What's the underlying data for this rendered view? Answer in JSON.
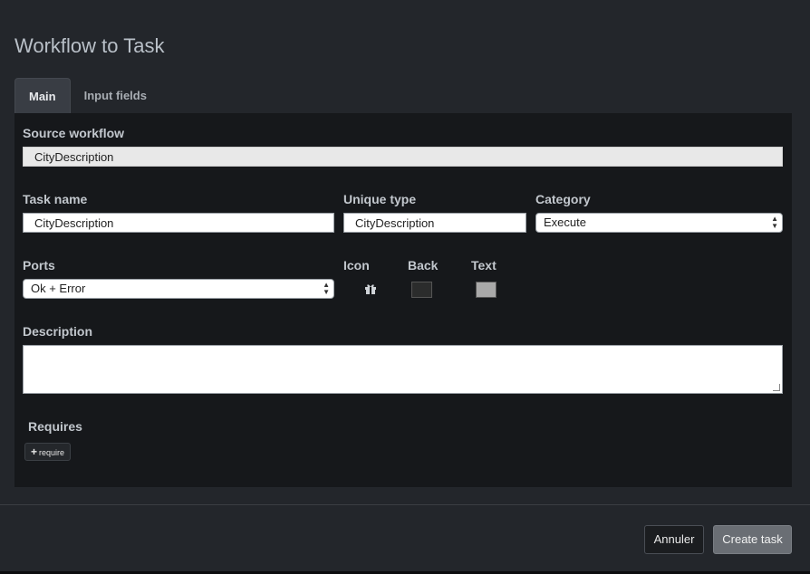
{
  "dialog": {
    "title": "Workflow to Task"
  },
  "tabs": [
    {
      "label": "Main",
      "active": true
    },
    {
      "label": "Input fields",
      "active": false
    }
  ],
  "form": {
    "source_workflow": {
      "label": "Source workflow",
      "value": "CityDescription"
    },
    "task_name": {
      "label": "Task name",
      "value": "CityDescription"
    },
    "unique_type": {
      "label": "Unique type",
      "value": "CityDescription"
    },
    "category": {
      "label": "Category",
      "value": "Execute"
    },
    "ports": {
      "label": "Ports",
      "value": "Ok + Error"
    },
    "icon": {
      "label": "Icon",
      "icon_name": "gift-icon"
    },
    "back": {
      "label": "Back",
      "color": "#2b2c2c"
    },
    "text": {
      "label": "Text",
      "color": "#a9a9a9"
    },
    "description": {
      "label": "Description",
      "value": ""
    },
    "requires": {
      "label": "Requires",
      "button_label": "require"
    }
  },
  "footer": {
    "cancel_label": "Annuler",
    "create_label": "Create task"
  },
  "colors": {
    "background": "#23262b",
    "panel": "#16181b",
    "primary_button": "#6a6e74"
  }
}
